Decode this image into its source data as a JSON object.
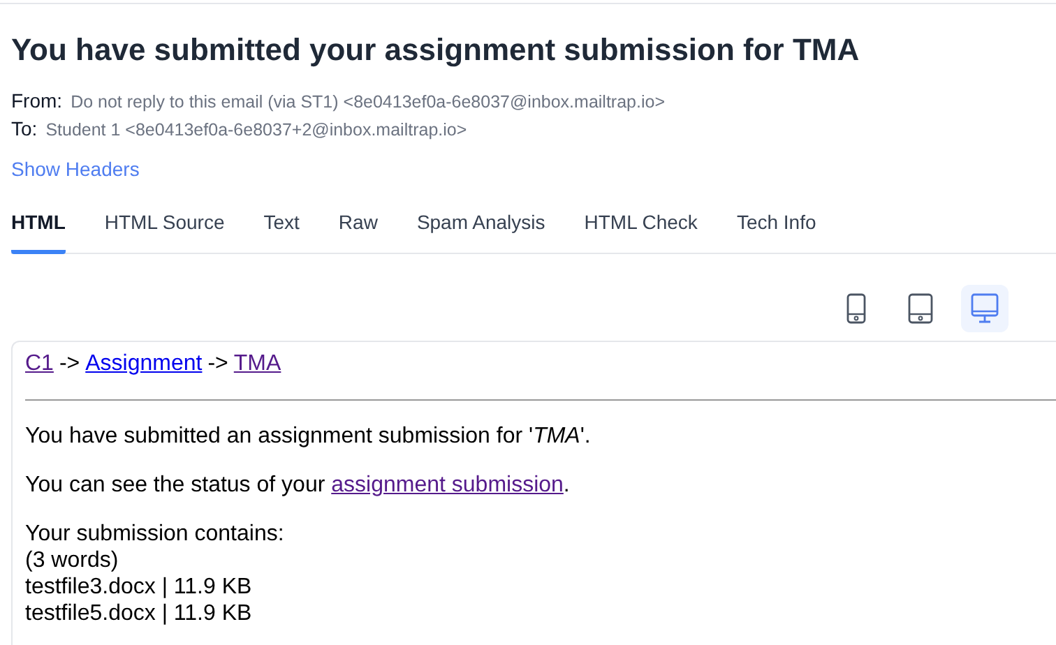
{
  "title": "You have submitted your assignment submission for TMA",
  "from": {
    "label": "From:",
    "value": "Do not reply to this email (via ST1) <8e0413ef0a-6e8037@inbox.mailtrap.io>"
  },
  "to": {
    "label": "To:",
    "value": "Student 1 <8e0413ef0a-6e8037+2@inbox.mailtrap.io>"
  },
  "show_headers": "Show Headers",
  "tabs": [
    {
      "label": "HTML",
      "selected": true
    },
    {
      "label": "HTML Source",
      "selected": false
    },
    {
      "label": "Text",
      "selected": false
    },
    {
      "label": "Raw",
      "selected": false
    },
    {
      "label": "Spam Analysis",
      "selected": false
    },
    {
      "label": "HTML Check",
      "selected": false
    },
    {
      "label": "Tech Info",
      "selected": false
    }
  ],
  "views": [
    {
      "kind": "phone",
      "selected": false
    },
    {
      "kind": "tablet",
      "selected": false
    },
    {
      "kind": "desktop",
      "selected": true
    }
  ],
  "email": {
    "breadcrumb": [
      {
        "label": "C1",
        "visited": true,
        "separator": "->"
      },
      {
        "label": "Assignment",
        "visited": false,
        "separator": "->"
      },
      {
        "label": "TMA",
        "visited": true
      }
    ],
    "intro": "You have submitted an assignment submission for '*TMA*'.",
    "status": {
      "before": "You can see the status of your",
      "link": "assignment submission",
      "after": "."
    },
    "contents": [
      "Your submission contains:",
      "(3 words)",
      "testfile3.docx | 11.9 KB",
      "testfile5.docx | 11.9 KB"
    ]
  }
}
